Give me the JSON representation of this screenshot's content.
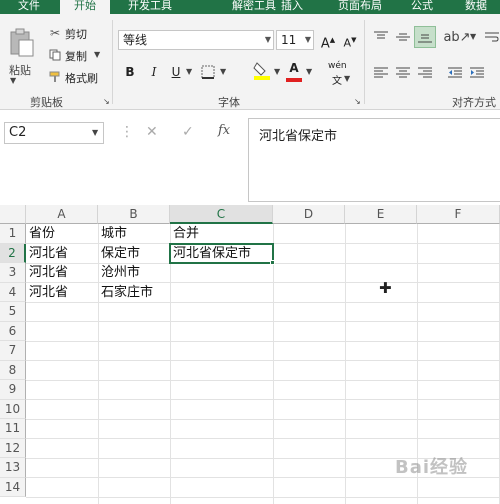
{
  "tabs": [
    "文件",
    "开始",
    "开发工具",
    "解密工具",
    "插入",
    "页面布局",
    "公式",
    "数据"
  ],
  "active_tab": "开始",
  "clipboard": {
    "paste": "粘贴",
    "cut": "剪切",
    "copy": "复制",
    "format_painter": "格式刷",
    "group_label": "剪贴板"
  },
  "font": {
    "font_name": "等线",
    "font_size": "11",
    "bold": "B",
    "italic": "I",
    "underline": "U",
    "font_color_letter": "A",
    "phonetic": "wén",
    "group_label": "字体"
  },
  "alignment": {
    "group_label": "对齐方式"
  },
  "formula_bar": {
    "name_box": "C2",
    "cancel": "✕",
    "confirm": "✓",
    "fx": "fx",
    "content": "河北省保定市"
  },
  "sheet": {
    "columns": [
      "A",
      "B",
      "C",
      "D",
      "E",
      "F"
    ],
    "rows": [
      "1",
      "2",
      "3",
      "4",
      "5",
      "6",
      "7",
      "8",
      "9",
      "10",
      "11",
      "12",
      "13",
      "14"
    ],
    "selected_cell": "C2",
    "cells": [
      [
        "省份",
        "城市",
        "合并"
      ],
      [
        "河北省",
        "保定市",
        "河北省保定市"
      ],
      [
        "河北省",
        "沧州市",
        ""
      ],
      [
        "河北省",
        "石家庄市",
        ""
      ]
    ]
  },
  "watermark": "Bai经验",
  "colors": {
    "excel_green": "#217346",
    "ribbon_bg": "#f3f3f3",
    "highlight_yellow": "#ffff00",
    "font_red": "#e02020"
  }
}
